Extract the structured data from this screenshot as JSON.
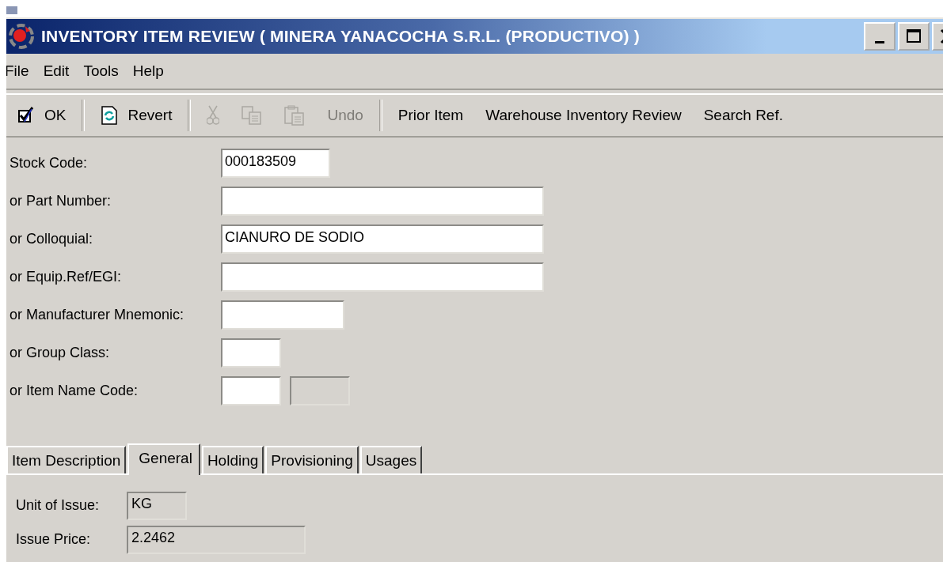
{
  "window": {
    "title": "INVENTORY ITEM REVIEW ( MINERA YANACOCHA S.R.L. (PRODUCTIVO) )"
  },
  "menu": [
    "File",
    "Edit",
    "Tools",
    "Help"
  ],
  "toolbar": [
    {
      "kind": "ok",
      "label": "OK",
      "disabled": false
    },
    {
      "kind": "separator"
    },
    {
      "kind": "revert",
      "label": "Revert",
      "disabled": false
    },
    {
      "kind": "separator"
    },
    {
      "kind": "cut",
      "disabled": true
    },
    {
      "kind": "copy",
      "disabled": true
    },
    {
      "kind": "paste",
      "disabled": true
    },
    {
      "kind": "text",
      "label": "Undo",
      "disabled": true
    },
    {
      "kind": "separator"
    },
    {
      "kind": "text",
      "label": "Prior Item",
      "disabled": false
    },
    {
      "kind": "text",
      "label": "Warehouse Inventory Review",
      "disabled": false
    },
    {
      "kind": "text",
      "label": "Search Ref.",
      "disabled": false
    }
  ],
  "fields": [
    {
      "label": "Stock Code:",
      "boxes": [
        {
          "value": "000183509",
          "disabled": false
        }
      ]
    },
    {
      "label": "or Part Number:",
      "boxes": [
        {
          "disabled": false
        }
      ]
    },
    {
      "label": "or Colloquial:",
      "boxes": [
        {
          "value": "CIANURO DE SODIO",
          "disabled": false
        }
      ]
    },
    {
      "label": "or Equip.Ref/EGI:",
      "boxes": [
        {
          "disabled": false
        }
      ]
    },
    {
      "label": "or Manufacturer Mnemonic:",
      "boxes": [
        {
          "disabled": false
        }
      ]
    },
    {
      "label": "or Group Class:",
      "boxes": [
        {
          "disabled": false
        }
      ]
    },
    {
      "label": "or Item Name Code:",
      "boxes": [
        {
          "disabled": false
        },
        {
          "disabled": true
        }
      ]
    }
  ],
  "tabs": [
    {
      "label": "Item Description",
      "selected": false
    },
    {
      "label": "General",
      "selected": true
    },
    {
      "label": "Holding",
      "selected": false
    },
    {
      "label": "Provisioning",
      "selected": false
    },
    {
      "label": "Usages",
      "selected": false
    }
  ],
  "general": [
    {
      "label": "Unit of Issue:",
      "value": "KG"
    },
    {
      "label": "Issue Price:",
      "value": "2.2462"
    }
  ]
}
